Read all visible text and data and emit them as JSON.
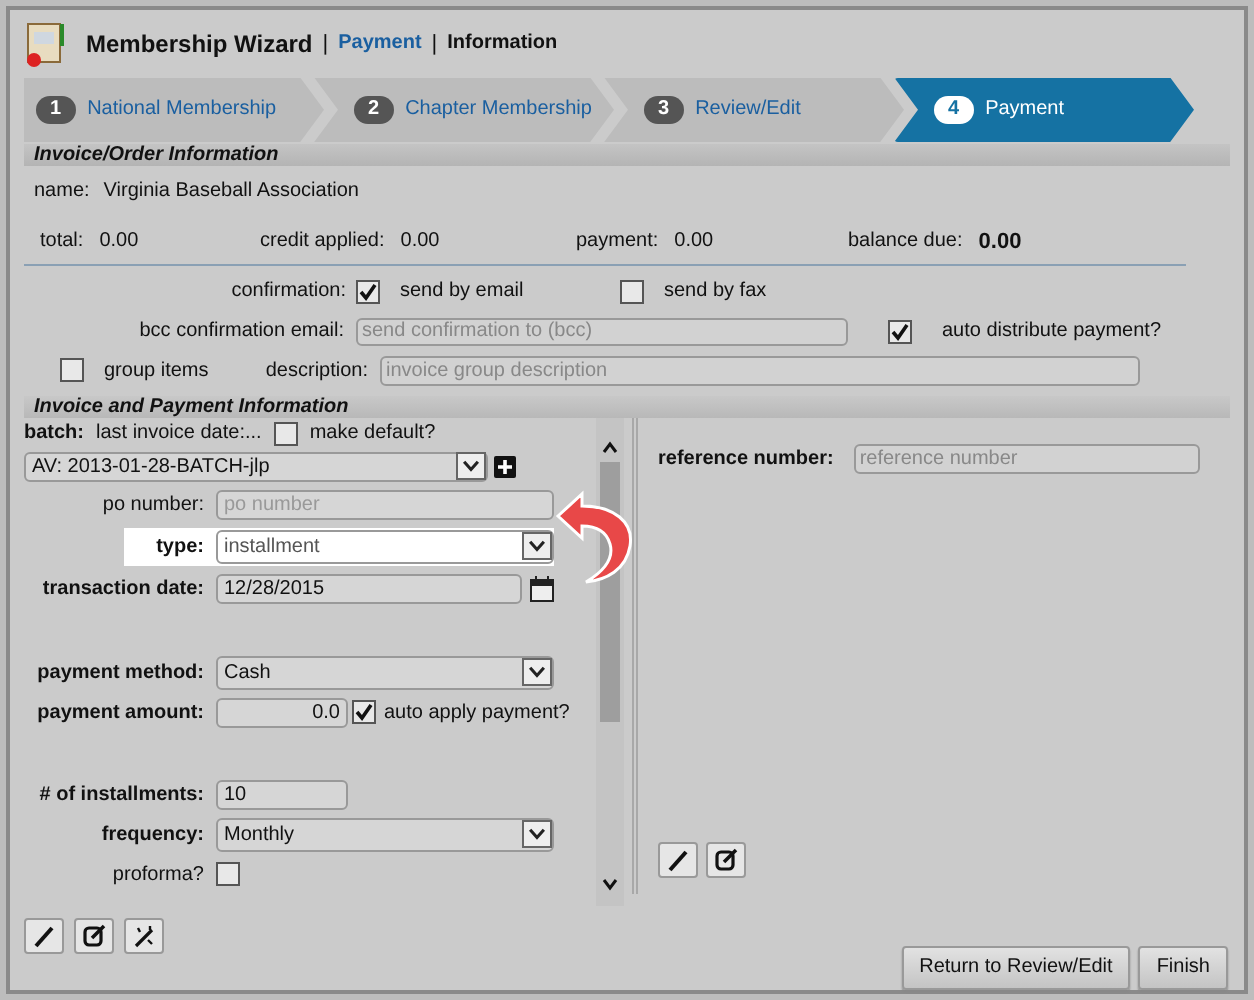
{
  "header": {
    "title": "Membership Wizard",
    "breadcrumb": [
      {
        "separator": "|",
        "label": "Payment",
        "link": true
      },
      {
        "separator": "|",
        "label": "Information",
        "link": false
      }
    ]
  },
  "steps": [
    {
      "number": "1",
      "label": "National Membership",
      "selected": false
    },
    {
      "number": "2",
      "label": "Chapter Membership",
      "selected": false
    },
    {
      "number": "3",
      "label": "Review/Edit",
      "selected": false
    },
    {
      "number": "4",
      "label": "Payment",
      "selected": true
    }
  ],
  "invoice_section": {
    "title": "Invoice/Order Information",
    "name_label": "name:",
    "name_value": "Virginia Baseball Association",
    "totals": [
      {
        "label": "total:",
        "value": "0.00",
        "emphasis": false
      },
      {
        "label": "credit applied:",
        "value": "0.00",
        "emphasis": false
      },
      {
        "label": "payment:",
        "value": "0.00",
        "emphasis": false
      },
      {
        "label": "balance due:",
        "value": "0.00",
        "emphasis": true
      }
    ],
    "confirmation": {
      "label": "confirmation:",
      "options": [
        {
          "label": "send by email",
          "checked": true
        },
        {
          "label": "send by fax",
          "checked": false
        }
      ]
    },
    "bcc": {
      "label": "bcc confirmation email:",
      "placeholder": "send confirmation to (bcc)"
    },
    "auto_distribute": {
      "label": "auto distribute payment?",
      "checked": true
    },
    "group_items": {
      "label": "group items",
      "checked": false
    },
    "description": {
      "label": "description:",
      "placeholder": "invoice group description"
    }
  },
  "payment_section": {
    "title": "Invoice and Payment Information",
    "batch": {
      "label": "batch:",
      "last_invoice_label": "last invoice date:...",
      "make_default": {
        "label": "make default?",
        "checked": false
      },
      "value": "AV: 2013-01-28-BATCH-jlp"
    },
    "fields": [
      {
        "kind": "input",
        "label": "po number:",
        "placeholder": "po number",
        "bold": false,
        "highlighted": false
      },
      {
        "kind": "select",
        "label": "type:",
        "value": "installment",
        "bold": true,
        "highlighted": true
      },
      {
        "kind": "date",
        "label": "transaction date:",
        "value": "12/28/2015",
        "bold": true,
        "highlighted": false
      },
      {
        "kind": "spacer"
      },
      {
        "kind": "select",
        "label": "payment method:",
        "value": "Cash",
        "bold": true,
        "highlighted": false
      },
      {
        "kind": "amount",
        "label": "payment amount:",
        "value": "0.0",
        "bold": true,
        "highlighted": false,
        "option": {
          "label": "auto apply payment?",
          "checked": true
        }
      },
      {
        "kind": "spacer"
      },
      {
        "kind": "short",
        "label": "# of installments:",
        "value": "10",
        "bold": true,
        "highlighted": false
      },
      {
        "kind": "select",
        "label": "frequency:",
        "value": "Monthly",
        "bold": true,
        "highlighted": false
      },
      {
        "kind": "checkbox",
        "label": "proforma?",
        "checked": false,
        "bold": false,
        "highlighted": false
      }
    ],
    "reference": {
      "label": "reference number:",
      "placeholder": "reference number"
    }
  },
  "buttons": [
    {
      "label": "Return to Review/Edit"
    },
    {
      "label": "Finish"
    }
  ]
}
